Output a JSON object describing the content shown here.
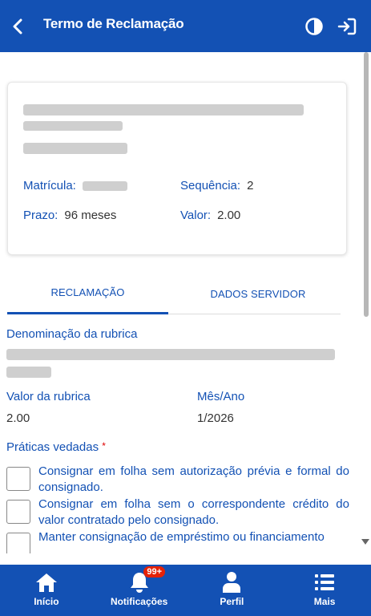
{
  "header": {
    "title": "Termo de Reclamação"
  },
  "card": {
    "matricula_label": "Matrícula:",
    "sequencia_label": "Sequência:",
    "sequencia_value": "2",
    "prazo_label": "Prazo:",
    "prazo_value": "96 meses",
    "valor_label": "Valor:",
    "valor_value": "2.00"
  },
  "tabs": [
    {
      "label": "RECLAMAÇÃO",
      "active": true
    },
    {
      "label": "DADOS SERVIDOR",
      "active": false
    }
  ],
  "form": {
    "denominacao_label": "Denominação da rubrica",
    "valor_rubrica_label": "Valor da rubrica",
    "valor_rubrica_value": "2.00",
    "mes_ano_label": "Mês/Ano",
    "mes_ano_value": "1/2026",
    "praticas_label": "Práticas vedadas",
    "required_mark": "*",
    "praticas": [
      "Consignar em folha sem autorização prévia e formal do consignado.",
      "Consignar em folha sem o correspondente crédito do valor contratado pelo consignado.",
      "Manter consignação de empréstimo ou financiamento"
    ]
  },
  "bottom_nav": {
    "items": [
      {
        "label": "Início",
        "icon": "home-icon"
      },
      {
        "label": "Notificações",
        "icon": "bell-icon",
        "badge": "99+"
      },
      {
        "label": "Perfil",
        "icon": "user-icon"
      },
      {
        "label": "Mais",
        "icon": "list-icon"
      }
    ]
  },
  "colors": {
    "primary": "#1351b4",
    "badge": "#e52207",
    "redaction": "#cfcfcf"
  }
}
